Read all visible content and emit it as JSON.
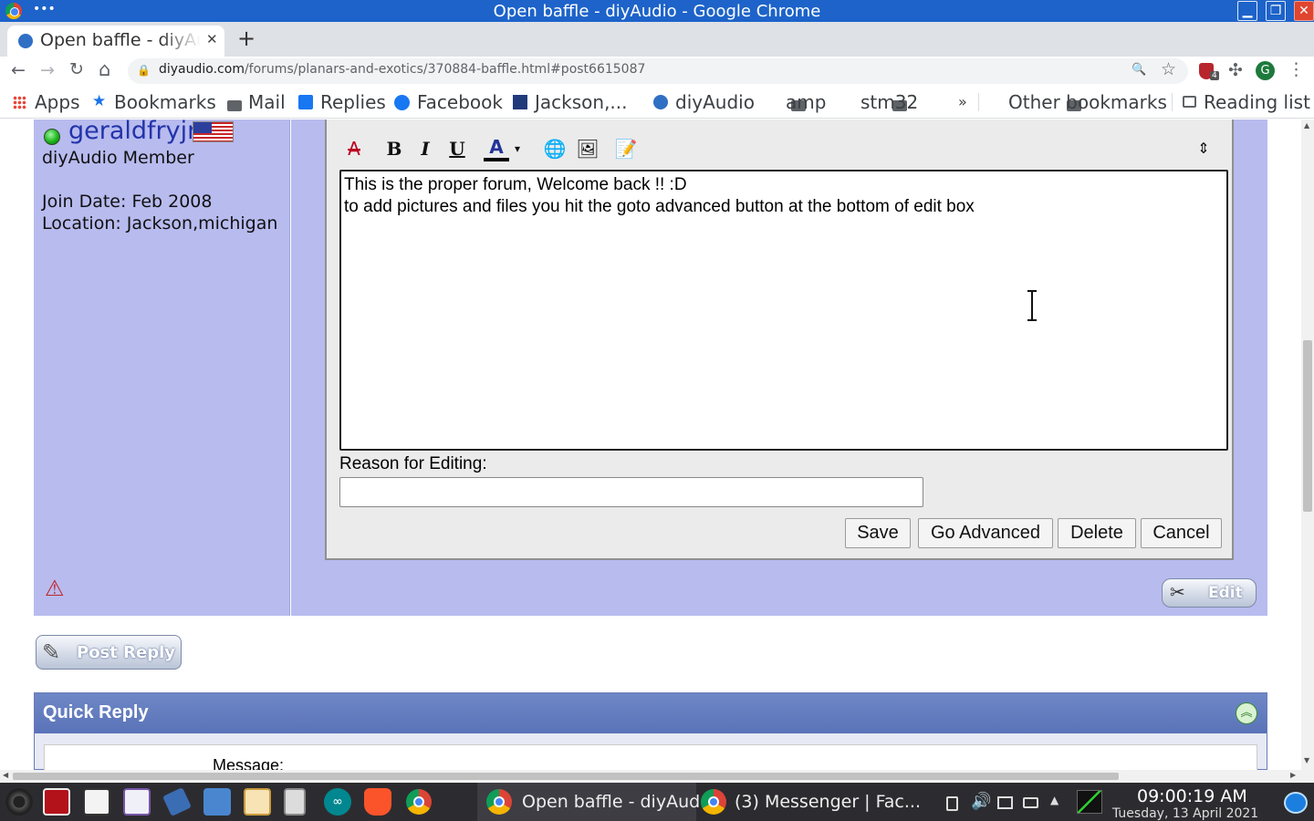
{
  "window": {
    "title": "Open baffle - diyAudio - Google Chrome",
    "menu_dots": "•••",
    "minimize": "▁",
    "restore": "❐",
    "close": "✕"
  },
  "tabs": [
    {
      "title": "Open baffle - diyAudio",
      "close": "✕",
      "active": true
    }
  ],
  "new_tab": "+",
  "toolbar": {
    "back": "←",
    "forward": "→",
    "reload": "↻",
    "home": "⌂",
    "lock": "🔒",
    "url_host": "diyaudio.com",
    "url_path": "/forums/planars-and-exotics/370884-baffle.html#post6615087",
    "zoom": "🔍",
    "star": "☆",
    "extensions_badge": "4",
    "puzzle": "✣",
    "profile_initial": "G",
    "menu": "⋮"
  },
  "bookmarks": {
    "apps": "Apps",
    "items": [
      "Bookmarks",
      "Mail",
      "Replies",
      "Facebook",
      "Jackson,...",
      "diyAudio",
      "amp",
      "stm32"
    ],
    "overflow": "»",
    "other": "Other bookmarks",
    "reading_list": "Reading list"
  },
  "post": {
    "username": "geraldfryjr",
    "user_title": "diyAudio Member",
    "join_date": "Join Date: Feb 2008",
    "location": "Location: Jackson,michigan",
    "editor_toolbar": {
      "remove_format": "A̶",
      "bold": "B",
      "italic": "I",
      "underline": "U",
      "font_color": "A",
      "dropdown": "▾",
      "link": "🌐",
      "image": "🖼",
      "quote": "📝",
      "resize": "⇕"
    },
    "message_lines": [
      "This is the proper forum, Welcome back !! :D",
      "to add pictures and files you hit the goto advanced button at the bottom of  edit box"
    ],
    "reason_label": "Reason for Editing:",
    "reason_value": "",
    "buttons": {
      "save": "Save",
      "go_advanced": "Go Advanced",
      "delete": "Delete",
      "cancel": "Cancel"
    },
    "report_icon": "⚠",
    "edit_button": "Edit"
  },
  "post_reply": "Post Reply",
  "quick_reply": {
    "title": "Quick Reply",
    "collapse": "︽",
    "message_label": "Message:"
  },
  "taskbar": {
    "windows": [
      {
        "title": "Open baffle - diyAud...",
        "active": true
      },
      {
        "title": "(3) Messenger | Fac...",
        "active": false
      }
    ],
    "clock_time": "09:00:19 AM",
    "clock_date": "Tuesday, 13 April 2021"
  },
  "colors": {
    "title_bar": "#1d63c9",
    "post_background": "#b8bbee",
    "username": "#2233aa",
    "quick_reply_header": "#5a73b8"
  }
}
